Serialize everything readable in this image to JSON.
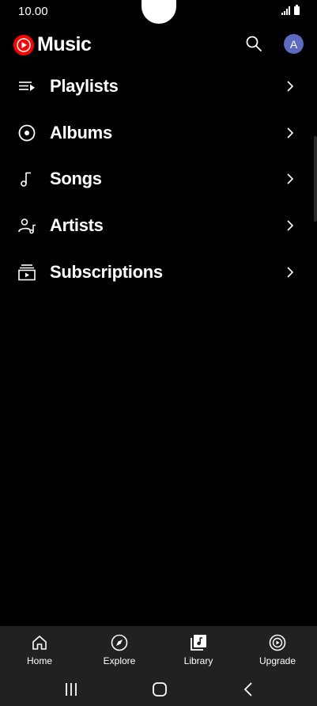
{
  "status_bar": {
    "time": "10.00"
  },
  "header": {
    "app_name": "Music",
    "avatar_initial": "A"
  },
  "menu": {
    "items": [
      {
        "label": "Playlists",
        "icon": "playlist-icon"
      },
      {
        "label": "Albums",
        "icon": "album-icon"
      },
      {
        "label": "Songs",
        "icon": "music-note-icon"
      },
      {
        "label": "Artists",
        "icon": "artist-icon"
      },
      {
        "label": "Subscriptions",
        "icon": "subscriptions-icon"
      }
    ]
  },
  "bottom_nav": {
    "items": [
      {
        "label": "Home",
        "icon": "home-icon"
      },
      {
        "label": "Explore",
        "icon": "compass-icon"
      },
      {
        "label": "Library",
        "icon": "library-icon",
        "selected": true
      },
      {
        "label": "Upgrade",
        "icon": "upgrade-icon"
      }
    ]
  },
  "colors": {
    "background": "#000000",
    "brand_red": "#ff0000",
    "nav_background": "#212121",
    "avatar": "#5c6bc0"
  }
}
